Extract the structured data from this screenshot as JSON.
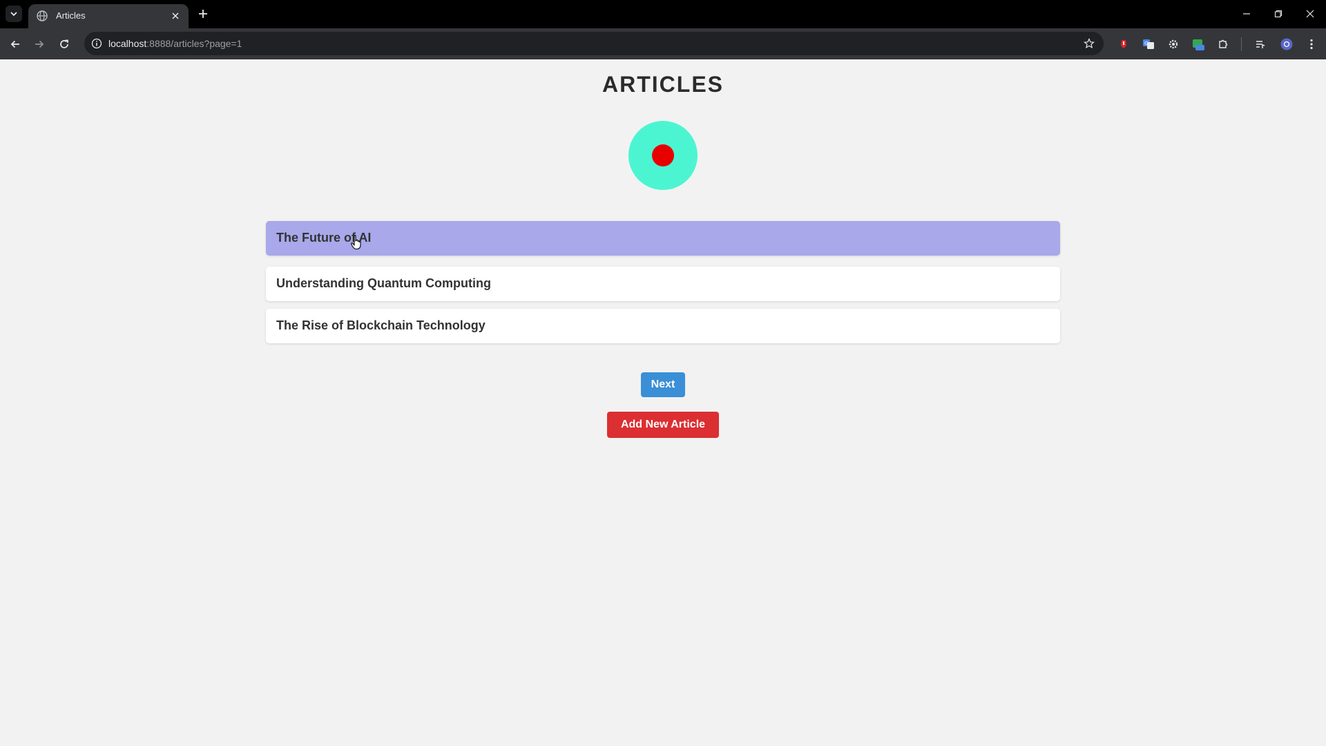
{
  "browser": {
    "tab_title": "Articles",
    "url_host": "localhost",
    "url_rest": ":8888/articles?page=1"
  },
  "page": {
    "title": "ARTICLES",
    "articles": [
      {
        "title": "The Future of AI",
        "hovered": true
      },
      {
        "title": "Understanding Quantum Computing",
        "hovered": false
      },
      {
        "title": "The Rise of Blockchain Technology",
        "hovered": false
      }
    ],
    "next_label": "Next",
    "add_label": "Add New Article"
  },
  "colors": {
    "logo_ring": "#4cf5d2",
    "logo_dot": "#e80000",
    "hover_row": "#a8a8ea",
    "next_button": "#3a8fd6",
    "add_button": "#db2f32"
  },
  "icons": {
    "tab_favicon": "globe-icon",
    "cursor": "hand-pointer-icon"
  }
}
